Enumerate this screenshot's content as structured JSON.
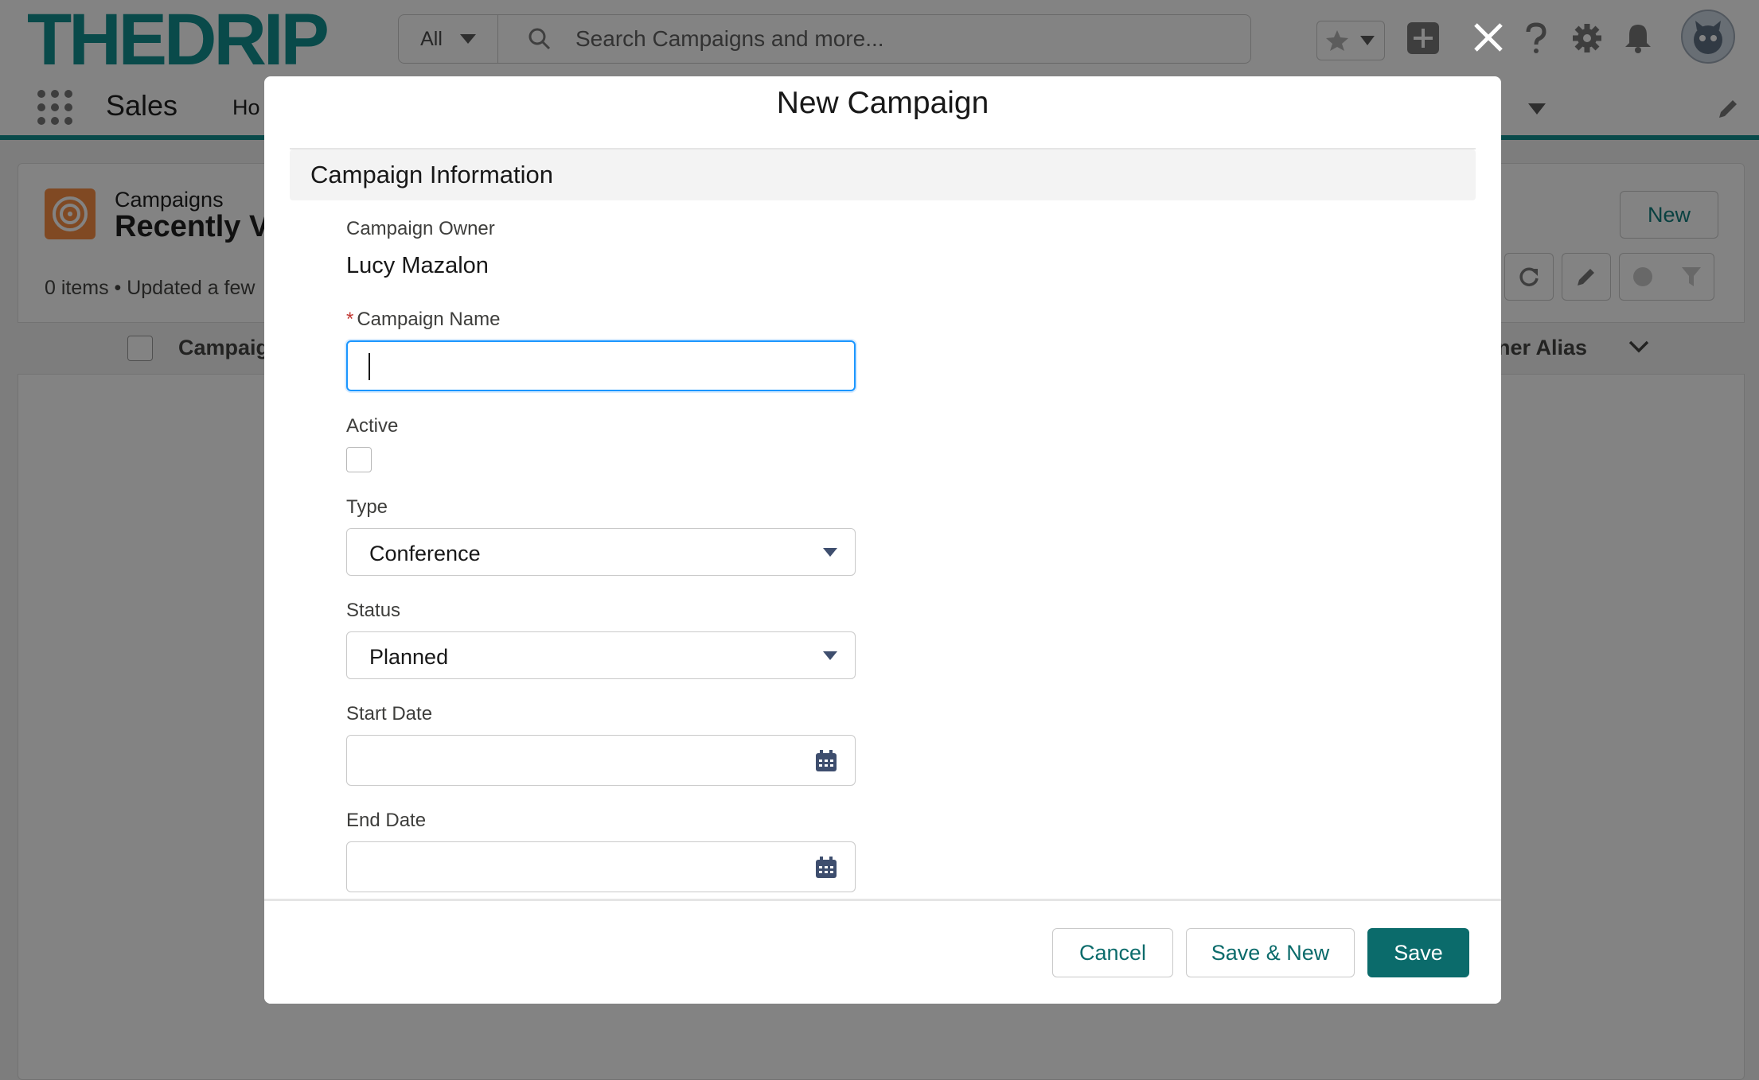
{
  "header": {
    "logo": "THEDRIP",
    "search_scope": "All",
    "search_placeholder": "Search Campaigns and more..."
  },
  "nav": {
    "app_name": "Sales",
    "home_partial": "Ho"
  },
  "list_view": {
    "object_label": "Campaigns",
    "title_partial": "Recently Vi",
    "meta_partial": "0 items • Updated a few",
    "new_button": "New",
    "columns": {
      "campaign_partial": "Campaig",
      "owner_partial": "wner Alias"
    }
  },
  "modal": {
    "title": "New Campaign",
    "section_title": "Campaign Information",
    "fields": {
      "owner": {
        "label": "Campaign Owner",
        "value": "Lucy Mazalon"
      },
      "name": {
        "label": "Campaign Name",
        "required_marker": "*",
        "value": ""
      },
      "active": {
        "label": "Active",
        "checked": false
      },
      "type": {
        "label": "Type",
        "value": "Conference"
      },
      "status": {
        "label": "Status",
        "value": "Planned"
      },
      "start_date": {
        "label": "Start Date",
        "value": ""
      },
      "end_date": {
        "label": "End Date",
        "value": ""
      }
    },
    "buttons": {
      "cancel": "Cancel",
      "save_new": "Save & New",
      "save": "Save"
    }
  },
  "colors": {
    "brand": "#0b8c8c",
    "primary_button": "#0b6b6b",
    "focus": "#1b96ff",
    "required": "#c23934",
    "campaign_icon": "#f88a3e"
  }
}
